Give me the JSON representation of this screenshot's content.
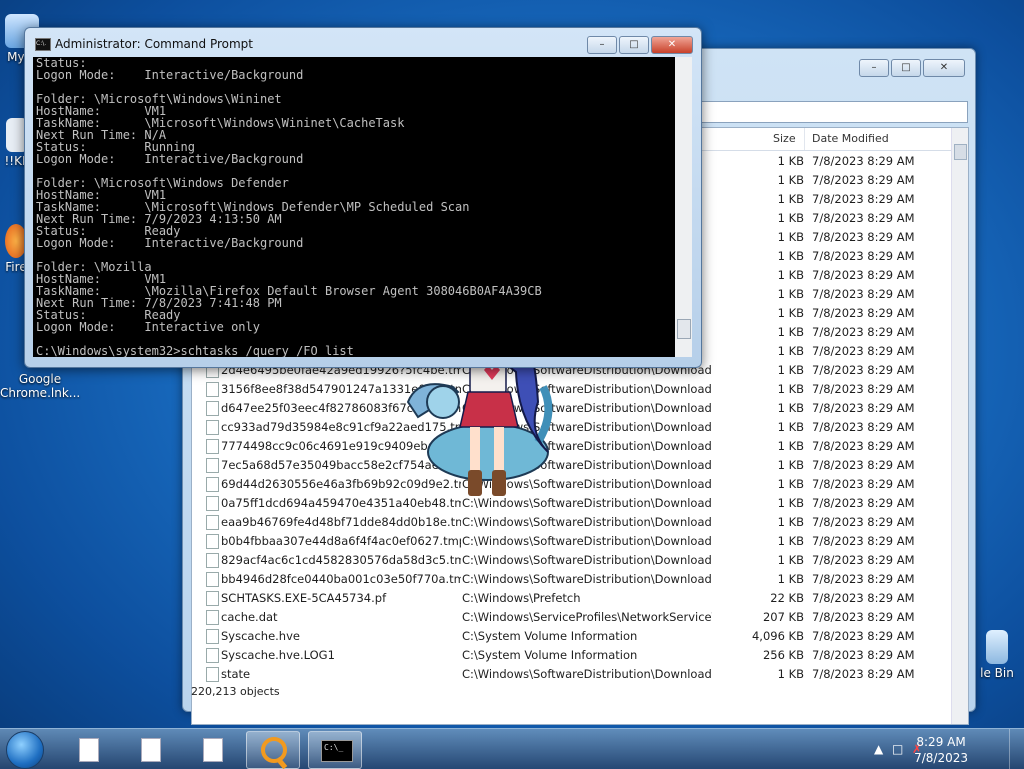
{
  "desktop": {
    "icons": [
      {
        "label": "My C"
      },
      {
        "label": "!!KE"
      },
      {
        "label": "Fire"
      },
      {
        "label": "Google Chrome.lnk..."
      },
      {
        "label": "le Bin"
      }
    ]
  },
  "explorer": {
    "columns": {
      "size": "Size",
      "date": "Date Modified"
    },
    "rows": [
      {
        "name": "",
        "folder": "",
        "size": "1 KB",
        "date": "7/8/2023 8:29 AM"
      },
      {
        "name": "",
        "folder": "",
        "size": "1 KB",
        "date": "7/8/2023 8:29 AM"
      },
      {
        "name": "",
        "folder": "",
        "size": "1 KB",
        "date": "7/8/2023 8:29 AM"
      },
      {
        "name": "",
        "folder": "",
        "size": "1 KB",
        "date": "7/8/2023 8:29 AM"
      },
      {
        "name": "",
        "folder": "",
        "size": "1 KB",
        "date": "7/8/2023 8:29 AM"
      },
      {
        "name": "",
        "folder": "",
        "size": "1 KB",
        "date": "7/8/2023 8:29 AM"
      },
      {
        "name": "",
        "folder": "",
        "size": "1 KB",
        "date": "7/8/2023 8:29 AM"
      },
      {
        "name": "",
        "folder": "",
        "size": "1 KB",
        "date": "7/8/2023 8:29 AM"
      },
      {
        "name": "",
        "folder": "",
        "size": "1 KB",
        "date": "7/8/2023 8:29 AM"
      },
      {
        "name": "",
        "folder": "",
        "size": "1 KB",
        "date": "7/8/2023 8:29 AM"
      },
      {
        "name": "",
        "folder": "",
        "size": "1 KB",
        "date": "7/8/2023 8:29 AM"
      },
      {
        "name": "2d4e6495be0fae42a9ed19926?5fc4be.tmp",
        "folder": "C:\\Windows\\SoftwareDistribution\\Download...",
        "size": "1 KB",
        "date": "7/8/2023 8:29 AM"
      },
      {
        "name": "3156f8ee8f38d547901247a1331e07c0.tmp",
        "folder": "C:\\Windows\\SoftwareDistribution\\Download...",
        "size": "1 KB",
        "date": "7/8/2023 8:29 AM"
      },
      {
        "name": "d647ee25f03eec4f82786083f67ca14a.tmp",
        "folder": "C:\\Windows\\SoftwareDistribution\\Download...",
        "size": "1 KB",
        "date": "7/8/2023 8:29 AM"
      },
      {
        "name": "cc933ad79d35984e8c91cf9a22aed175.tmp",
        "folder": "C:\\Windows\\SoftwareDistribution\\Download...",
        "size": "1 KB",
        "date": "7/8/2023 8:29 AM"
      },
      {
        "name": "7774498cc9c06c4691e919c9409eba54.tmp",
        "folder": "C:\\Windows\\SoftwareDistribution\\Download...",
        "size": "1 KB",
        "date": "7/8/2023 8:29 AM"
      },
      {
        "name": "7ec5a68d57e35049bacc58e2cf754aec.tmp",
        "folder": "C:\\Windows\\SoftwareDistribution\\Download...",
        "size": "1 KB",
        "date": "7/8/2023 8:29 AM"
      },
      {
        "name": "69d44d2630556e46a3fb69b92c09d9e2.tmp",
        "folder": "C:\\Windows\\SoftwareDistribution\\Download...",
        "size": "1 KB",
        "date": "7/8/2023 8:29 AM"
      },
      {
        "name": "0a75ff1dcd694a459470e4351a40eb48.tmp",
        "folder": "C:\\Windows\\SoftwareDistribution\\Download...",
        "size": "1 KB",
        "date": "7/8/2023 8:29 AM"
      },
      {
        "name": "eaa9b46769fe4d48bf71dde84dd0b18e.tmp",
        "folder": "C:\\Windows\\SoftwareDistribution\\Download...",
        "size": "1 KB",
        "date": "7/8/2023 8:29 AM"
      },
      {
        "name": "b0b4fbbaa307e44d8a6f4f4ac0ef0627.tmp",
        "folder": "C:\\Windows\\SoftwareDistribution\\Download...",
        "size": "1 KB",
        "date": "7/8/2023 8:29 AM"
      },
      {
        "name": "829acf4ac6c1cd4582830576da58d3c5.tmp",
        "folder": "C:\\Windows\\SoftwareDistribution\\Download...",
        "size": "1 KB",
        "date": "7/8/2023 8:29 AM"
      },
      {
        "name": "bb4946d28fce0440ba001c03e50f770a.tmp",
        "folder": "C:\\Windows\\SoftwareDistribution\\Download...",
        "size": "1 KB",
        "date": "7/8/2023 8:29 AM"
      },
      {
        "name": "SCHTASKS.EXE-5CA45734.pf",
        "folder": "C:\\Windows\\Prefetch",
        "size": "22 KB",
        "date": "7/8/2023 8:29 AM"
      },
      {
        "name": "cache.dat",
        "folder": "C:\\Windows\\ServiceProfiles\\NetworkService\\...",
        "size": "207 KB",
        "date": "7/8/2023 8:29 AM"
      },
      {
        "name": "Syscache.hve",
        "folder": "C:\\System Volume Information",
        "size": "4,096 KB",
        "date": "7/8/2023 8:29 AM"
      },
      {
        "name": "Syscache.hve.LOG1",
        "folder": "C:\\System Volume Information",
        "size": "256 KB",
        "date": "7/8/2023 8:29 AM"
      },
      {
        "name": "state",
        "folder": "C:\\Windows\\SoftwareDistribution\\Download...",
        "size": "1 KB",
        "date": "7/8/2023 8:29 AM"
      }
    ],
    "status": "220,213 objects"
  },
  "cmd": {
    "title": "Administrator: Command Prompt",
    "icon_text": "C:\\.",
    "lines": [
      "Status:",
      "Logon Mode:    Interactive/Background",
      "",
      "Folder: \\Microsoft\\Windows\\Wininet",
      "HostName:      VM1",
      "TaskName:      \\Microsoft\\Windows\\Wininet\\CacheTask",
      "Next Run Time: N/A",
      "Status:        Running",
      "Logon Mode:    Interactive/Background",
      "",
      "Folder: \\Microsoft\\Windows Defender",
      "HostName:      VM1",
      "TaskName:      \\Microsoft\\Windows Defender\\MP Scheduled Scan",
      "Next Run Time: 7/9/2023 4:13:50 AM",
      "Status:        Ready",
      "Logon Mode:    Interactive/Background",
      "",
      "Folder: \\Mozilla",
      "HostName:      VM1",
      "TaskName:      \\Mozilla\\Firefox Default Browser Agent 308046B0AF4A39CB",
      "Next Run Time: 7/8/2023 7:41:48 PM",
      "Status:        Ready",
      "Logon Mode:    Interactive only",
      "",
      "C:\\Windows\\system32>schtasks /query /FO list_"
    ]
  },
  "taskbar": {
    "cmd_icon_text": "C:\\_",
    "clock_time": "8:29 AM",
    "clock_date": "7/8/2023"
  }
}
